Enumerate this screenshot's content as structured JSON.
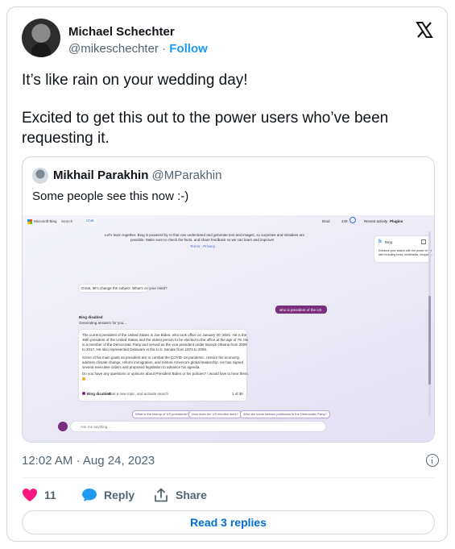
{
  "author": {
    "name": "Michael Schechter",
    "handle": "@mikeschechter",
    "separator": "·",
    "follow_label": "Follow"
  },
  "tweet": {
    "paragraphs": [
      "It’s like rain on your wedding day!",
      "Excited to get this out to the power users who’ve been requesting it."
    ]
  },
  "quote": {
    "name": "Mikhail Parakhin",
    "handle": "@MParakhin",
    "text": "Some people see this now :-)",
    "screenshot": {
      "brand": "Microsoft Bing",
      "tab_search": "Search",
      "tab_chat": "Chat",
      "top_right": {
        "label": "Brad",
        "points": "439",
        "recent_activity": "Recent activity",
        "plugins": "Plugins"
      },
      "intro_line1": "Let's learn together. Bing is powered by AI that can understand and generate text and images, so surprises and mistakes are",
      "intro_line2": "possible. Make sure to check the facts, and share feedback so we can learn and improve!",
      "terms": "Terms · Privacy",
      "plugin_name": "Bing",
      "plugin_desc1": "Enhance your search with the power of the",
      "plugin_desc2": "web including news, multimedia, shopping...",
      "bot_greeting": "Great, let's change the subject. What's on your mind?",
      "user_msg": "who is president of the US",
      "status1": "Bing disabled",
      "status2": "Generating answers for you...",
      "answer_lines": [
        "The current president of the United States is Joe Biden, who took office on January 20, 2021. He is the",
        "46th president of the United States and the oldest person to be elected to the office at the age of 78. He",
        "is a member of the Democratic Party and served as the vice president under Barack Obama from 2009",
        "to 2017. He also represented Delaware in the U.S. Senate from 1973 to 2009.",
        "",
        "Some of his main goals as president are to combat the COVID-19 pandemic, restore the economy,",
        "address climate change, reform immigration, and restore America's global leadership. He has signed",
        "several executive orders and proposed legislation to advance his agenda.",
        "Do you have any questions or opinions about President Biden or his policies? I would love to hear them."
      ],
      "answer_footer": "Bing disabled",
      "answer_footer_link": "Start a new topic, and activate search",
      "answer_count": "1 of 30",
      "suggestions": [
        "What is the history of US presidents?",
        "How does the US election work?",
        "Who are some famous politicians in the Democratic Party?"
      ],
      "input_placeholder": "Ask me anything..."
    }
  },
  "meta": {
    "time": "12:02 AM",
    "separator": "·",
    "date": "Aug 24, 2023"
  },
  "actions": {
    "likes": "11",
    "reply_label": "Reply",
    "share_label": "Share"
  },
  "replies_button": "Read 3 replies",
  "colors": {
    "like": "#f91880",
    "reply": "#1d9bf0",
    "link": "#006fd6",
    "follow": "#1d9bf0",
    "bing_purple": "#7a2e7e"
  },
  "icons": {
    "brand": "x-logo-icon",
    "like": "heart-icon",
    "reply": "speech-bubble-icon",
    "share": "share-icon",
    "info": "info-icon"
  }
}
